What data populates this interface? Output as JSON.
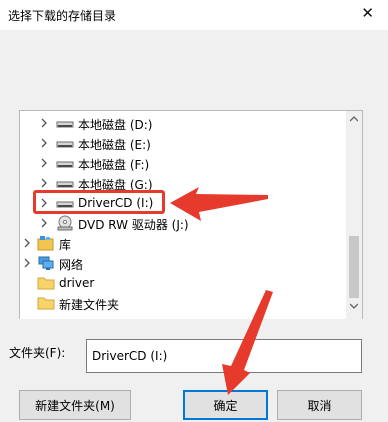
{
  "window": {
    "title": "选择下载的存储目录",
    "close_label": "✕"
  },
  "tree": {
    "items": [
      {
        "label": "本地磁盘 (D:)",
        "icon": "drive-icon",
        "expandable": true
      },
      {
        "label": "本地磁盘 (E:)",
        "icon": "drive-icon",
        "expandable": true
      },
      {
        "label": "本地磁盘 (F:)",
        "icon": "drive-icon",
        "expandable": true
      },
      {
        "label": "本地磁盘 (G:)",
        "icon": "drive-icon",
        "expandable": true
      },
      {
        "label": "DriverCD (I:)",
        "icon": "drive-icon",
        "expandable": true,
        "highlighted": true
      },
      {
        "label": "DVD RW 驱动器 (J:)",
        "icon": "dvd-drive-icon",
        "expandable": true
      },
      {
        "label": "库",
        "icon": "library-icon",
        "expandable": true
      },
      {
        "label": "网络",
        "icon": "network-icon",
        "expandable": true
      },
      {
        "label": "driver",
        "icon": "folder-icon",
        "expandable": false
      },
      {
        "label": "新建文件夹",
        "icon": "folder-icon",
        "expandable": false
      }
    ]
  },
  "folder_field": {
    "label": "文件夹(F):",
    "value": "DriverCD (I:)"
  },
  "buttons": {
    "new_folder": "新建文件夹(M)",
    "ok": "确定",
    "cancel": "取消"
  },
  "colors": {
    "annotation": "#e53a2c",
    "focus_border": "#0078d7",
    "background": "#f0f0f0"
  }
}
